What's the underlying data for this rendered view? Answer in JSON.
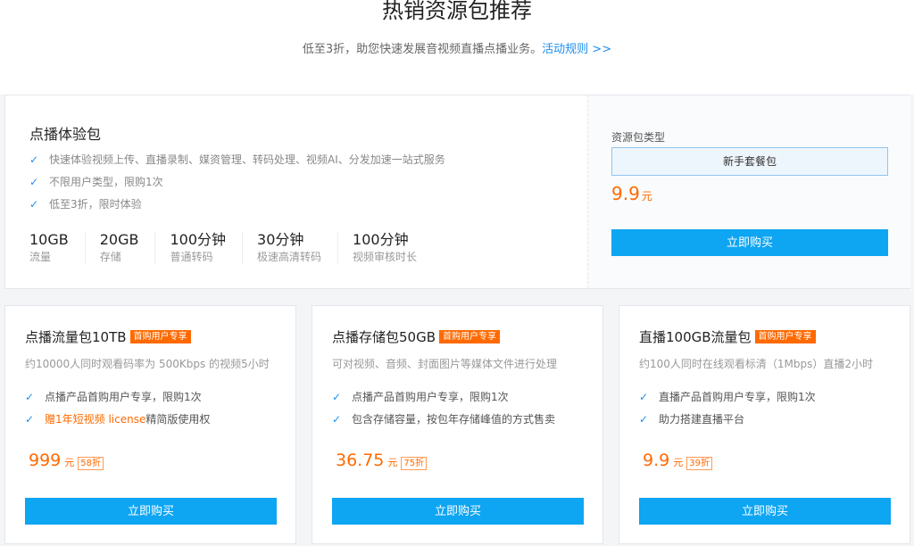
{
  "header": {
    "title": "热销资源包推荐",
    "subtitle": "低至3折，助您快速发展音视频直播点播业务。",
    "link": "活动规则 >>"
  },
  "colors": {
    "accent": "#0ea5f2",
    "price": "#ff6a00",
    "check": "#1e8ff0"
  },
  "top_package": {
    "title": "点播体验包",
    "features": [
      "快速体验视频上传、直播录制、媒资管理、转码处理、视频AI、分发加速一站式服务",
      "不限用户类型，限购1次",
      "低至3折，限时体验"
    ],
    "stats": [
      {
        "value": "10GB",
        "label": "流量"
      },
      {
        "value": "20GB",
        "label": "存储"
      },
      {
        "value": "100分钟",
        "label": "普通转码"
      },
      {
        "value": "30分钟",
        "label": "极速高清转码"
      },
      {
        "value": "100分钟",
        "label": "视频审核时长"
      }
    ],
    "type_label": "资源包类型",
    "type_option": "新手套餐包",
    "price": "9.9",
    "unit": "元",
    "buy": "立即购买"
  },
  "cards": [
    {
      "title": "点播流量包10TB",
      "badge": "首购用户专享",
      "desc": "约10000人同时观看码率为 500Kbps 的视频5小时",
      "features": [
        {
          "pre": "点播产品首购用户专享，限购1次",
          "hl": "",
          "post": ""
        },
        {
          "pre": "",
          "hl": "赠1年短视频 license",
          "post": " 精简版使用权"
        }
      ],
      "price": "999",
      "unit": "元",
      "discount": "58折",
      "buy": "立即购买"
    },
    {
      "title": "点播存储包50GB",
      "badge": "首购用户专享",
      "desc": "可对视频、音频、封面图片等媒体文件进行处理",
      "features": [
        {
          "pre": "点播产品首购用户专享，限购1次",
          "hl": "",
          "post": ""
        },
        {
          "pre": "包含存储容量，按包年存储峰值的方式售卖",
          "hl": "",
          "post": ""
        }
      ],
      "price": "36.75",
      "unit": "元",
      "discount": "75折",
      "buy": "立即购买"
    },
    {
      "title": "直播100GB流量包",
      "badge": "首购用户专享",
      "desc": "约100人同时在线观看标清（1Mbps）直播2小时",
      "features": [
        {
          "pre": "直播产品首购用户专享，限购1次",
          "hl": "",
          "post": ""
        },
        {
          "pre": "助力搭建直播平台",
          "hl": "",
          "post": ""
        }
      ],
      "price": "9.9",
      "unit": "元",
      "discount": "39折",
      "buy": "立即购买"
    }
  ]
}
